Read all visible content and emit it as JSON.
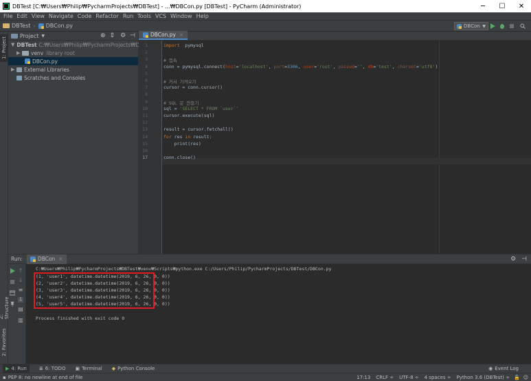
{
  "window": {
    "title": "DBTest [C:₩Users₩Philip₩PycharmProjects₩DBTest] - ...₩DBCon.py [DBTest] - PyCharm (Administrator)",
    "minimize": "─",
    "maximize": "☐",
    "close": "✕"
  },
  "menu": [
    "File",
    "Edit",
    "View",
    "Navigate",
    "Code",
    "Refactor",
    "Run",
    "Tools",
    "VCS",
    "Window",
    "Help"
  ],
  "nav": {
    "project": "DBTest",
    "file": "DBCon.py",
    "run_config": "DBCon"
  },
  "left_strip": {
    "project_tab": "1: Project",
    "structure_tab": "Z: Structure",
    "favorites_tab": "2: Favorites"
  },
  "project_panel": {
    "title": "Project",
    "root_name": "DBTest",
    "root_path": "C:₩Users₩Philip₩PycharmProjects₩DBTest",
    "venv": "venv",
    "venv_note": "library root",
    "file": "DBCon.py",
    "external": "External Libraries",
    "scratches": "Scratches and Consoles"
  },
  "editor": {
    "tab": "DBCon.py",
    "line_numbers": [
      "1",
      "2",
      "3",
      "4",
      "5",
      "6",
      "7",
      "8",
      "9",
      "10",
      "11",
      "12",
      "13",
      "14",
      "15",
      "16",
      "17"
    ],
    "current_line": "17"
  },
  "run_panel": {
    "label": "Run:",
    "tab": "DBCon",
    "command": "C:₩Users₩Philip₩PycharmProjects₩DBTest₩venv₩Scripts₩python.exe C:/Users/Philip/PycharmProjects/DBTest/DBCon.py",
    "output": [
      "(1, 'user1', datetime.datetime(2019, 6, 26, 0, 0))",
      "(2, 'user2', datetime.datetime(2019, 6, 26, 0, 0))",
      "(3, 'user3', datetime.datetime(2019, 6, 26, 0, 0))",
      "(4, 'user4', datetime.datetime(2019, 6, 26, 0, 0))",
      "(5, 'user5', datetime.datetime(2019, 6, 26, 0, 0))"
    ],
    "exit": "Process finished with exit code 0"
  },
  "bottom_tabs": {
    "run": "4: Run",
    "todo": "6: TODO",
    "terminal": "Terminal",
    "python_console": "Python Console",
    "event_log": "Event Log"
  },
  "status": {
    "message": "PEP 8: no newline at end of file",
    "position": "17:13",
    "line_sep": "CRLF ÷",
    "encoding": "UTF-8 ÷",
    "indent": "4 spaces ÷",
    "interpreter": "Python 3.6 (DBTest) ÷"
  },
  "colors": {
    "keyword": "#cc7832",
    "comment": "#808080",
    "string": "#6a8759",
    "number": "#6897bb",
    "highlight_box": "#e01b24"
  }
}
